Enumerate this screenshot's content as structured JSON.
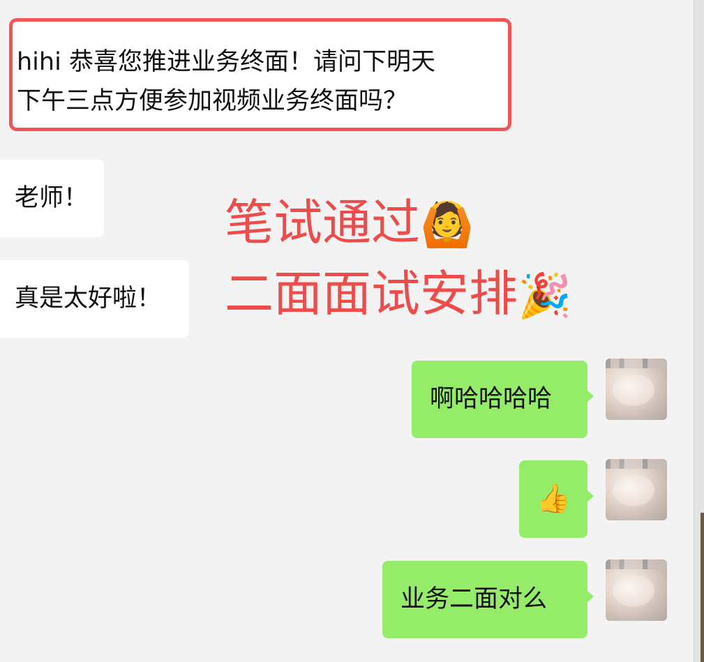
{
  "chat": {
    "messages": [
      {
        "direction": "incoming",
        "text": "hihi 恭喜您推进业务终面！请问下明天\n下午三点方便参加视频业务终面吗？",
        "highlighted": true,
        "highlight_color": "#f05454"
      },
      {
        "direction": "incoming",
        "text": "老师！"
      },
      {
        "direction": "incoming",
        "text": "真是太好啦！"
      },
      {
        "direction": "outgoing",
        "text": "啊哈哈哈哈"
      },
      {
        "direction": "outgoing",
        "text": "👍"
      },
      {
        "direction": "outgoing",
        "text": "业务二面对么"
      }
    ]
  },
  "overlay": {
    "line1": "笔试通过",
    "line1_emoji": "🙆",
    "line2": "二面面试安排",
    "line2_emoji": "🎉",
    "color": "#ee4b4b"
  },
  "colors": {
    "outgoing_bubble": "#95ec69",
    "incoming_bubble": "#ffffff",
    "background": "#f3f3f3"
  },
  "icons": {
    "avatar": "user-avatar-photo"
  }
}
